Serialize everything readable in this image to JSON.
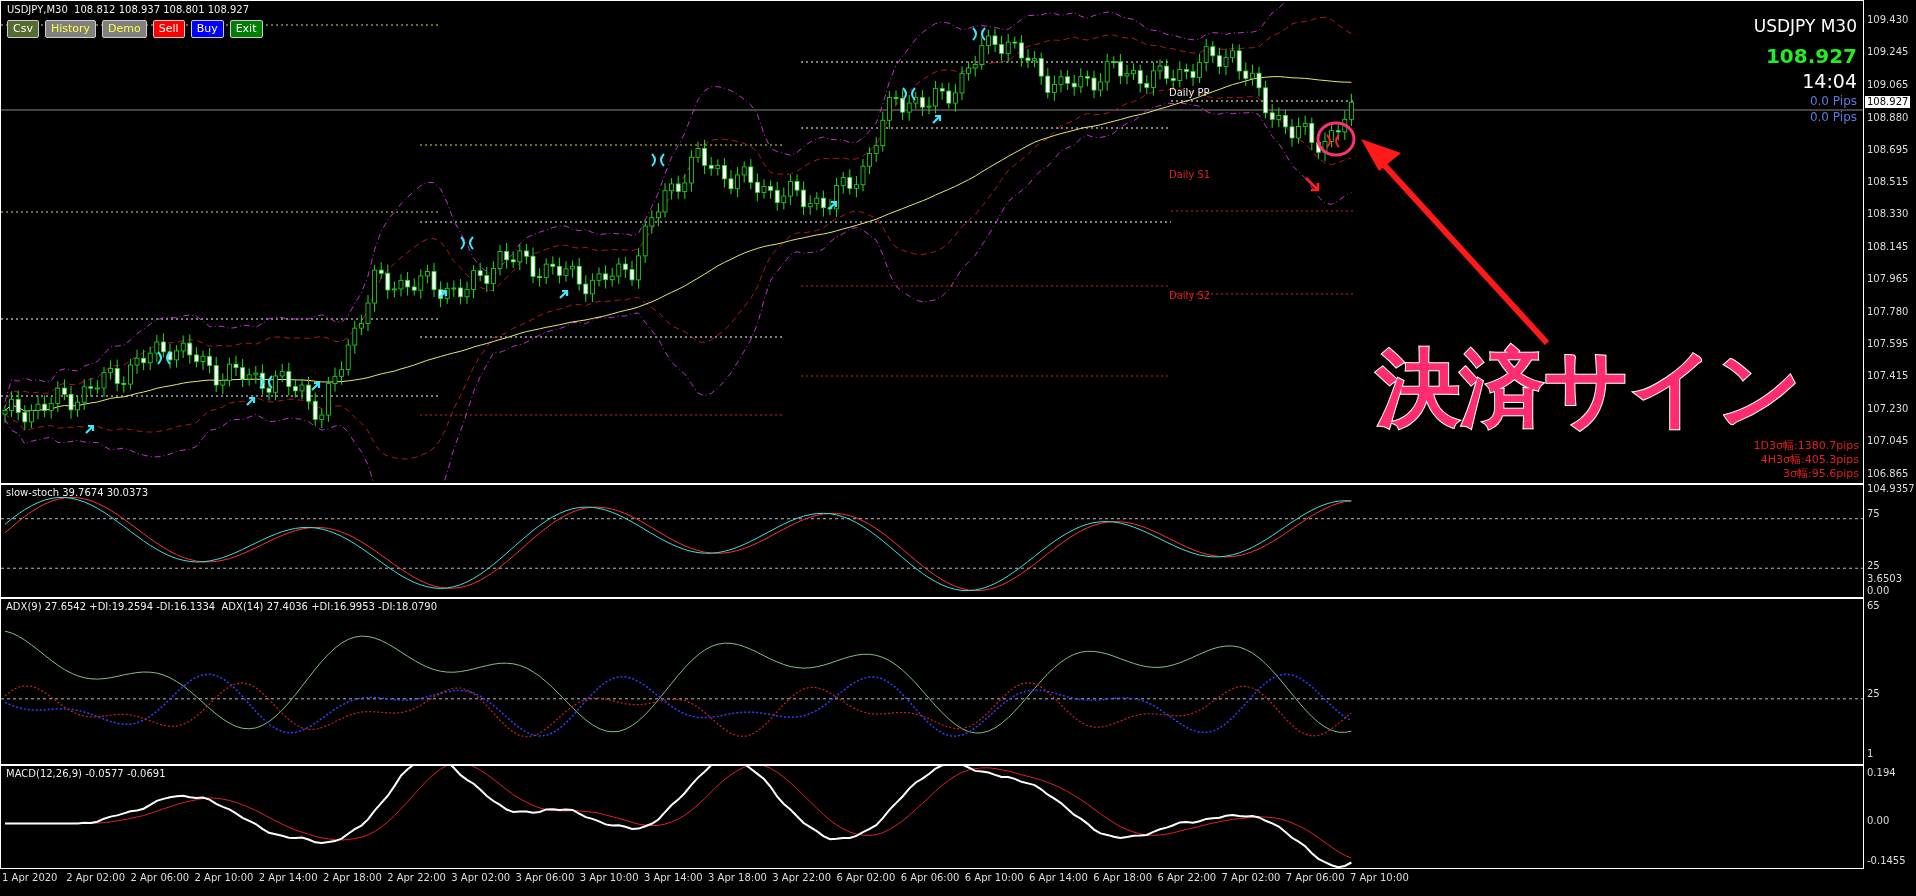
{
  "header": {
    "symbol_line": "USDJPY,M30  108.812 108.937 108.801 108.927"
  },
  "buttons": [
    {
      "label": "Csv",
      "color": "#556b2f"
    },
    {
      "label": "History",
      "color": "#808080"
    },
    {
      "label": "Demo",
      "color": "#808080"
    },
    {
      "label": "Sell",
      "color": "#ff0000"
    },
    {
      "label": "Buy",
      "color": "#0000ff"
    },
    {
      "label": "Exit",
      "color": "#008000"
    }
  ],
  "info_panel": {
    "symbol": "USDJPY M30",
    "price": "108.927",
    "time": "14:04",
    "pips": [
      "0.0 Pips",
      "0.0 Pips"
    ],
    "widths": [
      "1D3σ幅:1380.7pips",
      "4H3σ幅:405.3pips",
      "3σ幅:95.6pips"
    ]
  },
  "pivot_labels": [
    "Daily PP",
    "Daily S1",
    "Daily S2"
  ],
  "annotation": {
    "text": "決済サイン"
  },
  "price_axis": {
    "ticks": [
      "109.430",
      "109.245",
      "109.065",
      "108.880",
      "108.695",
      "108.515",
      "108.330",
      "108.145",
      "107.965",
      "107.780",
      "107.595",
      "107.415",
      "107.230",
      "107.045",
      "106.865"
    ],
    "current": "108.927"
  },
  "stoch_pane": {
    "label": "slow-stoch 39.7674 30.0373",
    "ticks": [
      "104.9357",
      "75",
      "25",
      "3.6503",
      "0.00"
    ]
  },
  "adx_pane": {
    "label": "ADX(9) 27.6542 +DI:19.2594 -DI:16.1334  ADX(14) 27.4036 +DI:16.9953 -DI:18.0790",
    "ticks": [
      "65",
      "25",
      "1"
    ]
  },
  "macd_pane": {
    "label": "MACD(12,26,9) -0.0577 -0.0691",
    "ticks": [
      "0.194",
      "0.00",
      "-0.1455"
    ]
  },
  "time_axis": [
    "1 Apr 2020",
    "2 Apr 02:00",
    "2 Apr 06:00",
    "2 Apr 10:00",
    "2 Apr 14:00",
    "2 Apr 18:00",
    "2 Apr 22:00",
    "3 Apr 02:00",
    "3 Apr 06:00",
    "3 Apr 10:00",
    "3 Apr 14:00",
    "3 Apr 18:00",
    "3 Apr 22:00",
    "6 Apr 02:00",
    "6 Apr 06:00",
    "6 Apr 10:00",
    "6 Apr 14:00",
    "6 Apr 18:00",
    "6 Apr 22:00",
    "7 Apr 02:00",
    "7 Apr 06:00",
    "7 Apr 10:00"
  ]
}
